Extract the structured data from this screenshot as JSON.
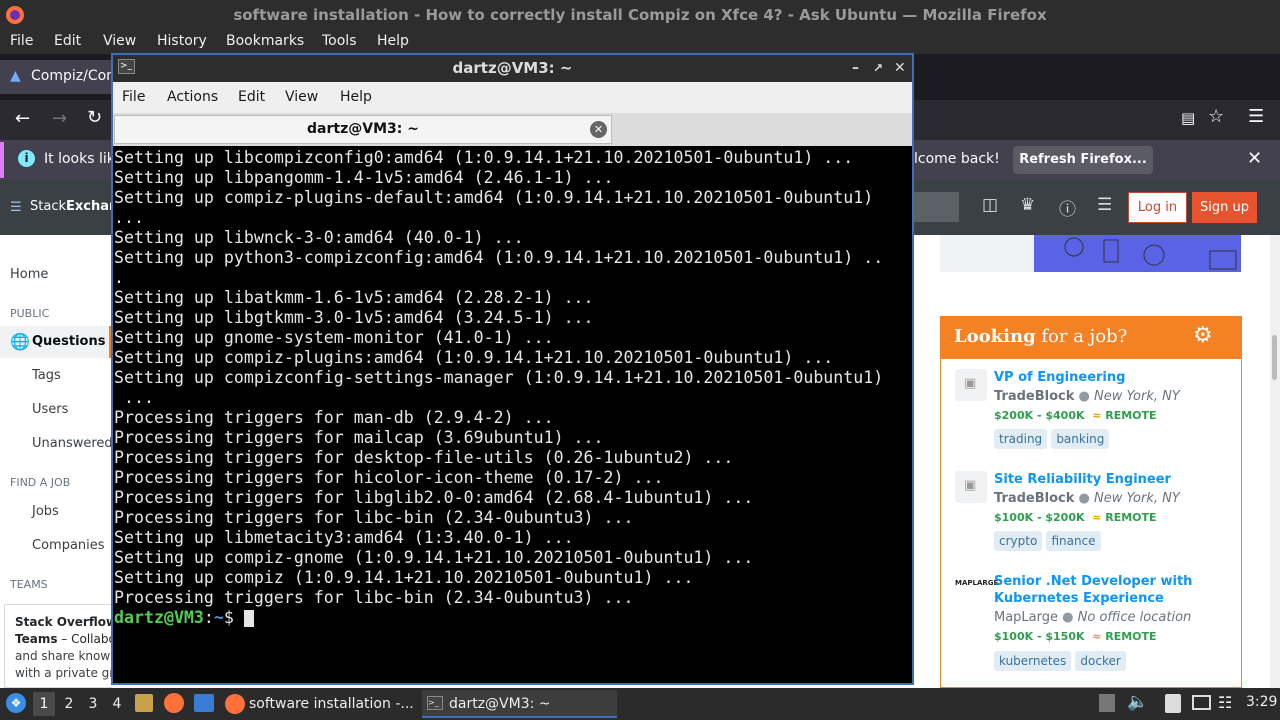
{
  "firefox": {
    "window_title": "software installation - How to correctly install Compiz on Xfce 4? - Ask Ubuntu — Mozilla Firefox",
    "menu": [
      "File",
      "Edit",
      "View",
      "History",
      "Bookmarks",
      "Tools",
      "Help"
    ],
    "tab_label": "Compiz/Con",
    "notice_text": "It looks lik",
    "notice_tail": "lcome back!",
    "refresh_button": "Refresh Firefox..."
  },
  "site": {
    "logo_a": "Stack",
    "logo_b": "Exchang",
    "login": "Log in",
    "signup": "Sign up",
    "nav": {
      "home": "Home",
      "public": "PUBLIC",
      "questions": "Questions",
      "tags": "Tags",
      "users": "Users",
      "unanswered": "Unanswered",
      "find_job": "FIND A JOB",
      "jobs": "Jobs",
      "companies": "Companies",
      "teams": "TEAMS"
    },
    "teams_promo": {
      "title": "Stack Overflow",
      "title2": "Teams",
      "desc1": " – Collabo",
      "desc2": "and share knowl",
      "desc3": "with a private gro"
    },
    "jobs_panel": {
      "heading_bold": "Looking",
      "heading_rest": "for a job?",
      "jobs": [
        {
          "title": "VP of Engineering",
          "company": "TradeBlock",
          "location": "New York, NY",
          "salary": "$200K - $400K",
          "remote": "REMOTE",
          "tags": [
            "trading",
            "banking"
          ]
        },
        {
          "title": "Site Reliability Engineer",
          "company": "TradeBlock",
          "location": "New York, NY",
          "salary": "$100K - $200K",
          "remote": "REMOTE",
          "tags": [
            "crypto",
            "finance"
          ]
        },
        {
          "title": "Senior .Net Developer with Kubernetes Experience",
          "title1": "Senior .Net Developer with",
          "title2": "Kubernetes Experience",
          "company": "MapLarge",
          "location": "No office location",
          "salary": "$100K - $150K",
          "remote": "REMOTE",
          "tags": [
            "kubernetes",
            "docker"
          ]
        }
      ]
    }
  },
  "terminal": {
    "title": "dartz@VM3: ~",
    "menu": [
      "File",
      "Actions",
      "Edit",
      "View",
      "Help"
    ],
    "tab_label": "dartz@VM3: ~",
    "lines": [
      "Setting up libcompizconfig0:amd64 (1:0.9.14.1+21.10.20210501-0ubuntu1) ...",
      "Setting up libpangomm-1.4-1v5:amd64 (2.46.1-1) ...",
      "Setting up compiz-plugins-default:amd64 (1:0.9.14.1+21.10.20210501-0ubuntu1)",
      "...",
      "Setting up libwnck-3-0:amd64 (40.0-1) ...",
      "Setting up python3-compizconfig:amd64 (1:0.9.14.1+21.10.20210501-0ubuntu1) ..",
      ".",
      "Setting up libatkmm-1.6-1v5:amd64 (2.28.2-1) ...",
      "Setting up libgtkmm-3.0-1v5:amd64 (3.24.5-1) ...",
      "Setting up gnome-system-monitor (41.0-1) ...",
      "Setting up compiz-plugins:amd64 (1:0.9.14.1+21.10.20210501-0ubuntu1) ...",
      "Setting up compizconfig-settings-manager (1:0.9.14.1+21.10.20210501-0ubuntu1)",
      " ...",
      "Processing triggers for man-db (2.9.4-2) ...",
      "Processing triggers for mailcap (3.69ubuntu1) ...",
      "Processing triggers for desktop-file-utils (0.26-1ubuntu2) ...",
      "Processing triggers for hicolor-icon-theme (0.17-2) ...",
      "Processing triggers for libglib2.0-0:amd64 (2.68.4-1ubuntu1) ...",
      "Processing triggers for libc-bin (2.34-0ubuntu3) ...",
      "Setting up libmetacity3:amd64 (1:3.40.0-1) ...",
      "Setting up compiz-gnome (1:0.9.14.1+21.10.20210501-0ubuntu1) ...",
      "Setting up compiz (1:0.9.14.1+21.10.20210501-0ubuntu1) ...",
      "Processing triggers for libc-bin (2.34-0ubuntu3) ..."
    ],
    "prompt_user": "dartz@VM3",
    "prompt_sep": ":",
    "prompt_path": "~",
    "prompt_end": "$ "
  },
  "taskbar": {
    "workspaces": [
      "1",
      "2",
      "3",
      "4"
    ],
    "firefox_task": "software installation -...",
    "terminal_task": "dartz@VM3: ~",
    "clock": "3:29"
  }
}
